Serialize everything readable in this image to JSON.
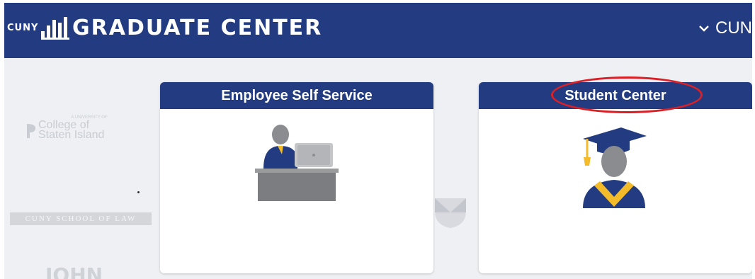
{
  "header": {
    "cuny_logo_text": "CUNY",
    "title": "GRADUATE CENTER",
    "menu_label": "CUN"
  },
  "background_logos": {
    "csi_small": "A UNIVERSITY OF",
    "csi_line1": "College of",
    "csi_line2": "Staten Island",
    "law": "CUNY SCHOOL OF LAW",
    "john": "JOHN"
  },
  "tiles": [
    {
      "title": "Employee Self Service",
      "icon": "employee-at-desk-icon"
    },
    {
      "title": "Student Center",
      "icon": "graduate-icon"
    }
  ],
  "colors": {
    "header_bg": "#233b80",
    "highlight": "#d92027",
    "gold": "#f3bb2a"
  }
}
